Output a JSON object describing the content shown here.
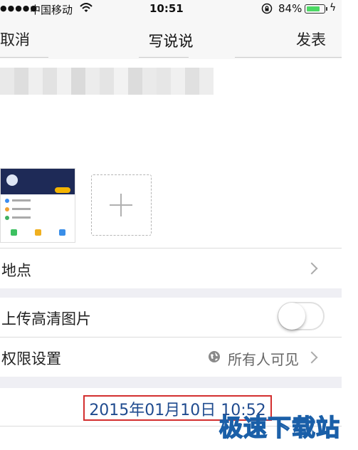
{
  "status_bar": {
    "signal": "●●●●●",
    "carrier": "中国移动",
    "time": "10:51",
    "battery_percent": "84%",
    "battery_level": 0.84,
    "battery_color": "#4cd964",
    "icons": [
      "wifi-icon",
      "orientation-lock-icon",
      "battery-icon",
      "charging-bolt-icon"
    ]
  },
  "nav": {
    "cancel_label": "取消",
    "title": "写说说",
    "publish_label": "发表"
  },
  "settings": {
    "location_label": "地点",
    "hd_upload_label": "上传高清图片",
    "hd_upload_enabled": false,
    "permission_label": "权限设置",
    "permission_value": "所有人可见"
  },
  "timestamp": {
    "value": "2015年01月10日 10:52",
    "text_color": "#1f4b8f",
    "highlight_color": "#d32f2f"
  },
  "watermark": "极速下载站"
}
